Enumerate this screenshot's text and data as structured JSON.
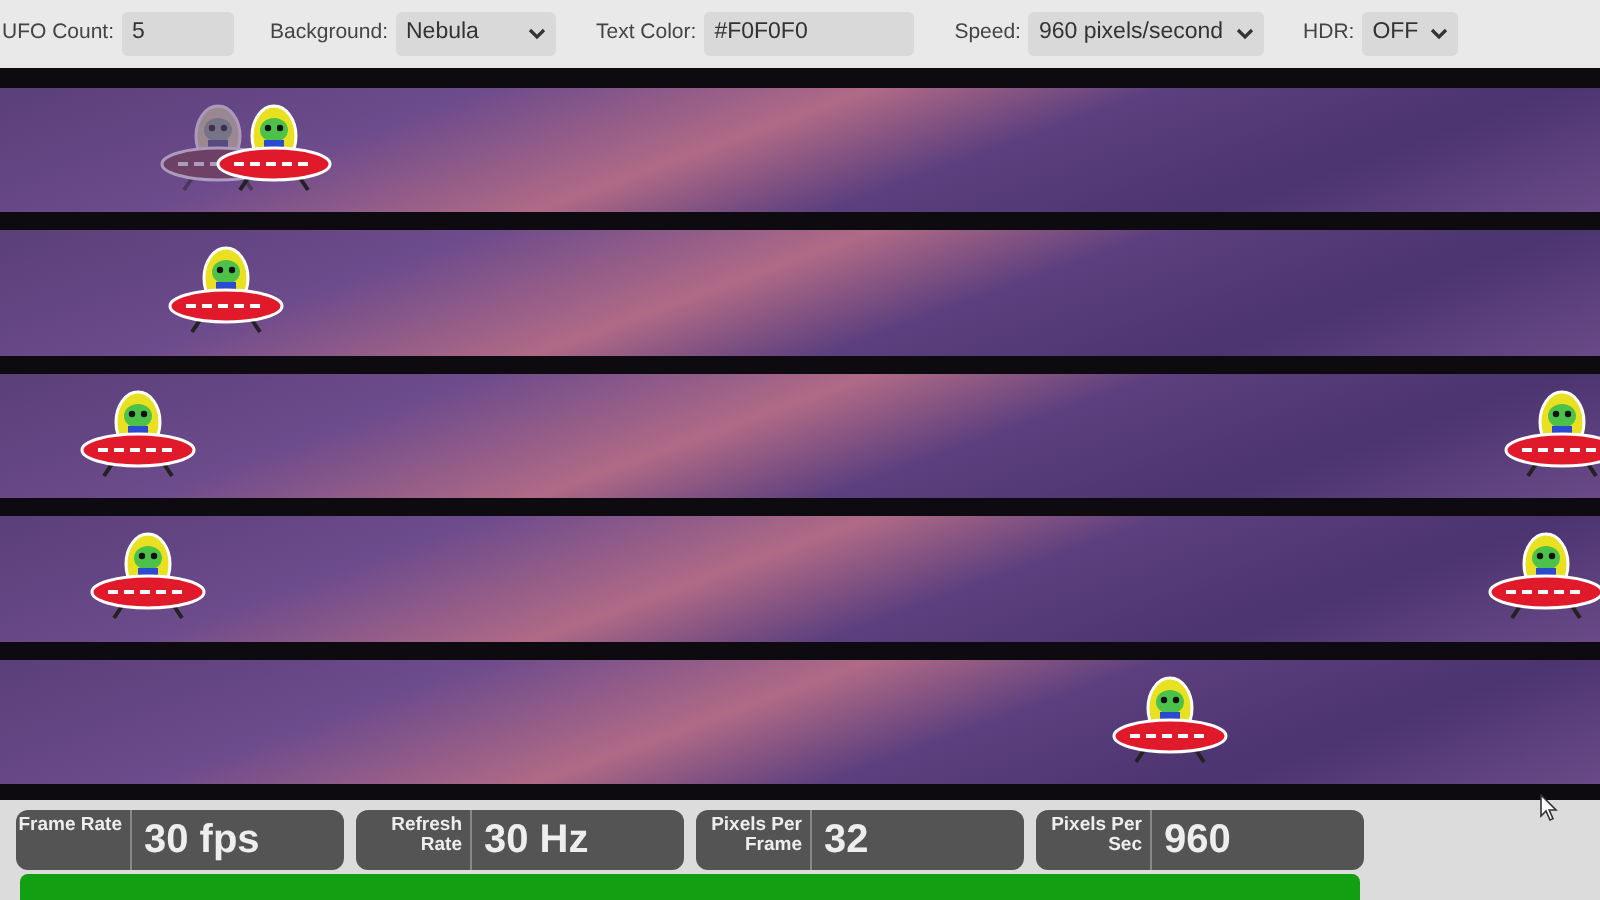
{
  "controls": [
    {
      "kind": "input",
      "label": "UFO Count:",
      "value": "5"
    },
    {
      "kind": "select",
      "label": "Background:",
      "value": "Nebula"
    },
    {
      "kind": "input",
      "label": "Text Color:",
      "value": "#F0F0F0"
    },
    {
      "kind": "select",
      "label": "Speed:",
      "value": "960 pixels/second"
    },
    {
      "kind": "select",
      "label": "HDR:",
      "value": "OFF"
    }
  ],
  "lanes": [
    {
      "ufos": [
        {
          "kind": "ghost"
        },
        {
          "kind": "ufo"
        }
      ]
    },
    {
      "ufos": [
        {
          "kind": "ufo"
        }
      ]
    },
    {
      "ufos": [
        {
          "kind": "ufo"
        },
        {
          "kind": "ufo"
        }
      ]
    },
    {
      "ufos": [
        {
          "kind": "ufo"
        },
        {
          "kind": "ufo"
        }
      ]
    },
    {
      "ufos": [
        {
          "kind": "ufo"
        }
      ]
    }
  ],
  "stats": [
    {
      "label": "Frame Rate",
      "value": "30 fps"
    },
    {
      "label": "Refresh Rate",
      "value": "30 Hz"
    },
    {
      "label": "Pixels Per Frame",
      "value": "32"
    },
    {
      "label": "Pixels Per Sec",
      "value": "960"
    }
  ],
  "status_bar": {
    "color": "#12a012"
  }
}
